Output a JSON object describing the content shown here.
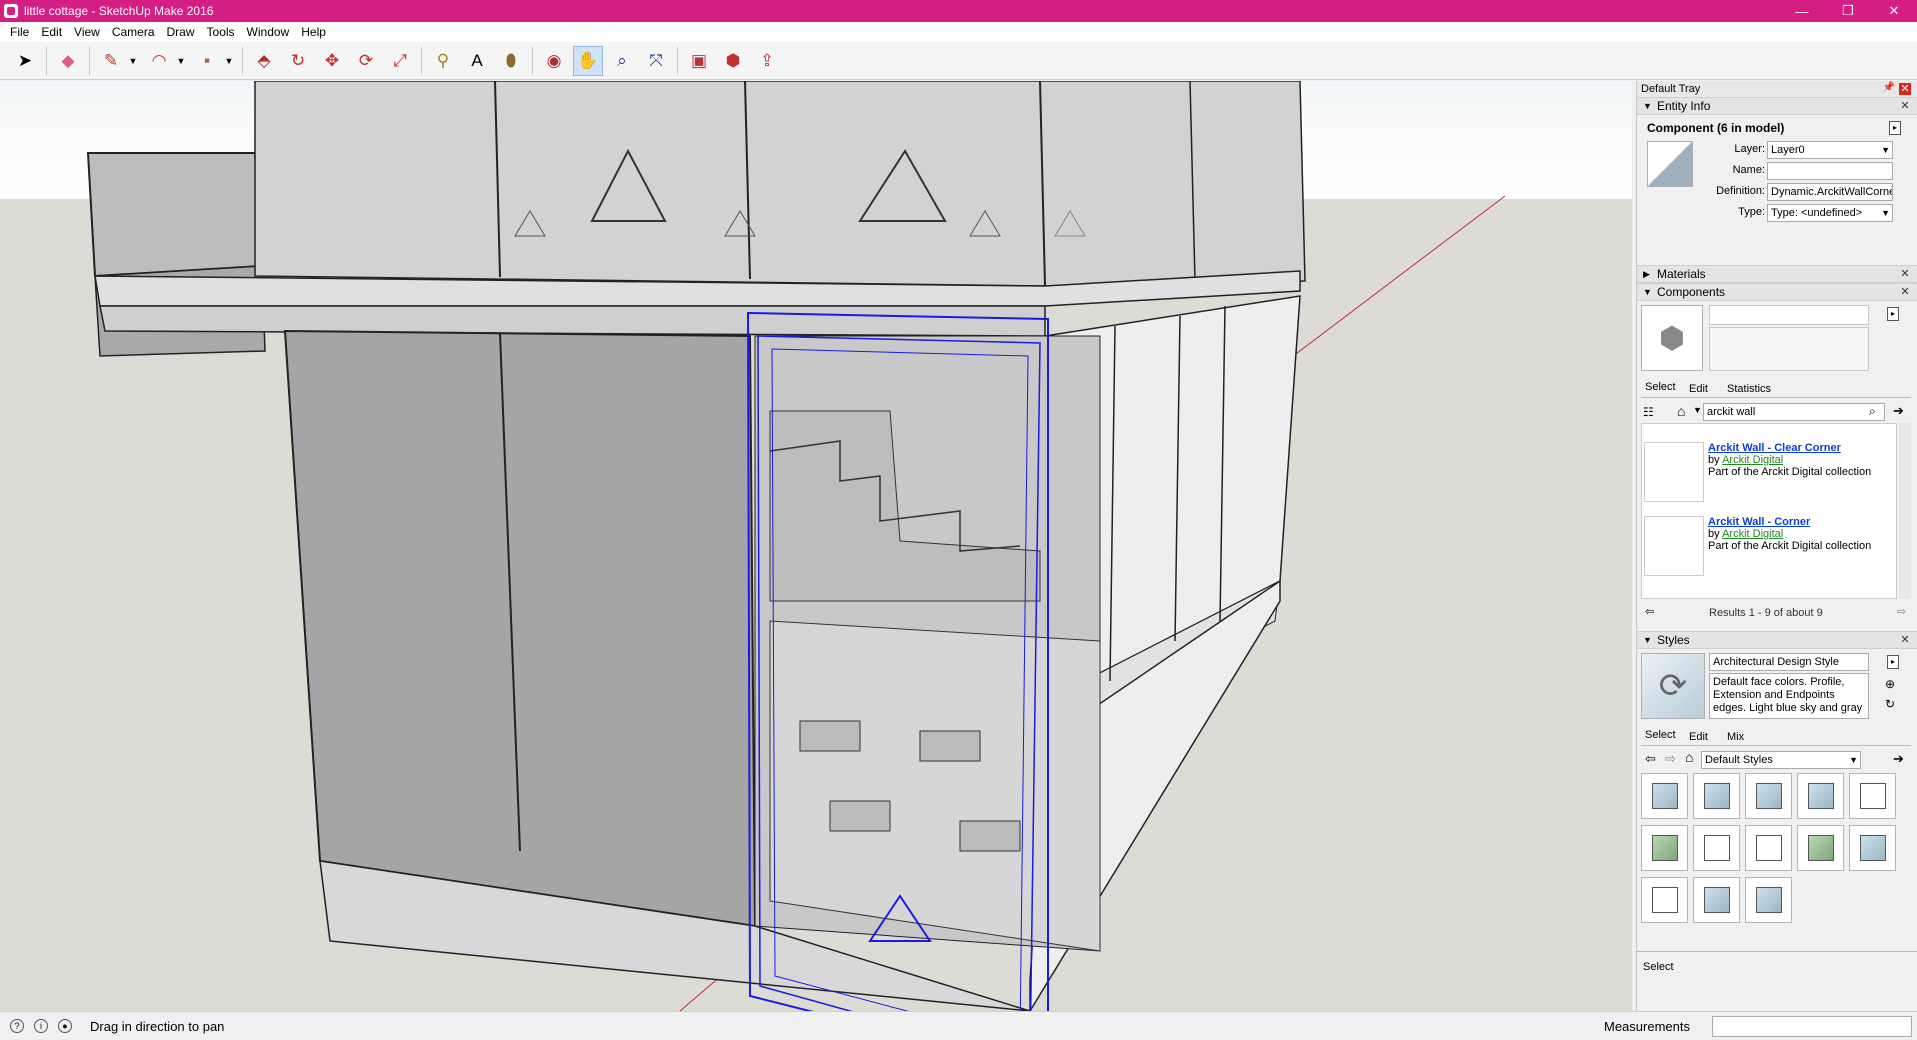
{
  "window": {
    "title": "little cottage - SketchUp Make 2016",
    "controls": {
      "minimize": "—",
      "maximize": "❐",
      "close": "✕"
    }
  },
  "menu": [
    "File",
    "Edit",
    "View",
    "Camera",
    "Draw",
    "Tools",
    "Window",
    "Help"
  ],
  "toolbar": {
    "tools": [
      {
        "name": "select-tool",
        "glyph": "➤"
      },
      {
        "name": "eraser-tool",
        "glyph": "◆"
      },
      {
        "name": "line-tool",
        "glyph": "✎"
      },
      {
        "name": "arc-tool",
        "glyph": "◠"
      },
      {
        "name": "rectangle-tool",
        "glyph": "▪"
      },
      {
        "name": "push-pull-tool",
        "glyph": "⬘"
      },
      {
        "name": "offset-tool",
        "glyph": "↻"
      },
      {
        "name": "move-tool",
        "glyph": "✥"
      },
      {
        "name": "rotate-tool",
        "glyph": "⟳"
      },
      {
        "name": "scale-tool",
        "glyph": "⤢"
      },
      {
        "name": "tape-measure-tool",
        "glyph": "⚲"
      },
      {
        "name": "text-tool",
        "glyph": "A"
      },
      {
        "name": "paint-bucket-tool",
        "glyph": "⬮"
      },
      {
        "name": "orbit-tool",
        "glyph": "◉"
      },
      {
        "name": "pan-tool",
        "glyph": "✋",
        "active": true
      },
      {
        "name": "zoom-tool",
        "glyph": "⌕"
      },
      {
        "name": "zoom-extents-tool",
        "glyph": "⤧"
      },
      {
        "name": "warehouse-tool",
        "glyph": "▣"
      },
      {
        "name": "extension-warehouse-tool",
        "glyph": "⬢"
      },
      {
        "name": "share-model-tool",
        "glyph": "⇪"
      }
    ]
  },
  "tray": {
    "title": "Default Tray",
    "entity_info": {
      "header": "Entity Info",
      "component_title": "Component (6 in model)",
      "layer_label": "Layer:",
      "layer_value": "Layer0",
      "name_label": "Name:",
      "name_value": "",
      "definition_label": "Definition:",
      "definition_value": "Dynamic.ArckitWallCorne",
      "type_label": "Type:",
      "type_value": "Type: <undefined>"
    },
    "materials": {
      "header": "Materials"
    },
    "components": {
      "header": "Components",
      "tabs": [
        "Select",
        "Edit",
        "Statistics"
      ],
      "search_value": "arckit wall",
      "results": [
        {
          "title": "Arckit Wall - Clear Corner",
          "by": "by",
          "author": "Arckit Digital",
          "desc": "Part of the Arckit Digital collection"
        },
        {
          "title": "Arckit Wall - Corner",
          "by": "by",
          "author": "Arckit Digital",
          "desc": "Part of the Arckit Digital collection"
        }
      ],
      "results_count": "Results 1 - 9 of about 9"
    },
    "styles": {
      "header": "Styles",
      "style_name": "Architectural Design Style",
      "style_desc": "Default face colors. Profile, Extension and Endpoints edges. Light blue sky and gray",
      "tabs": [
        "Select",
        "Edit",
        "Mix"
      ],
      "collection": "Default Styles",
      "bottom_label": "Select"
    }
  },
  "status": {
    "hint": "Drag in direction to pan",
    "measurements_label": "Measurements",
    "measurements_value": ""
  }
}
